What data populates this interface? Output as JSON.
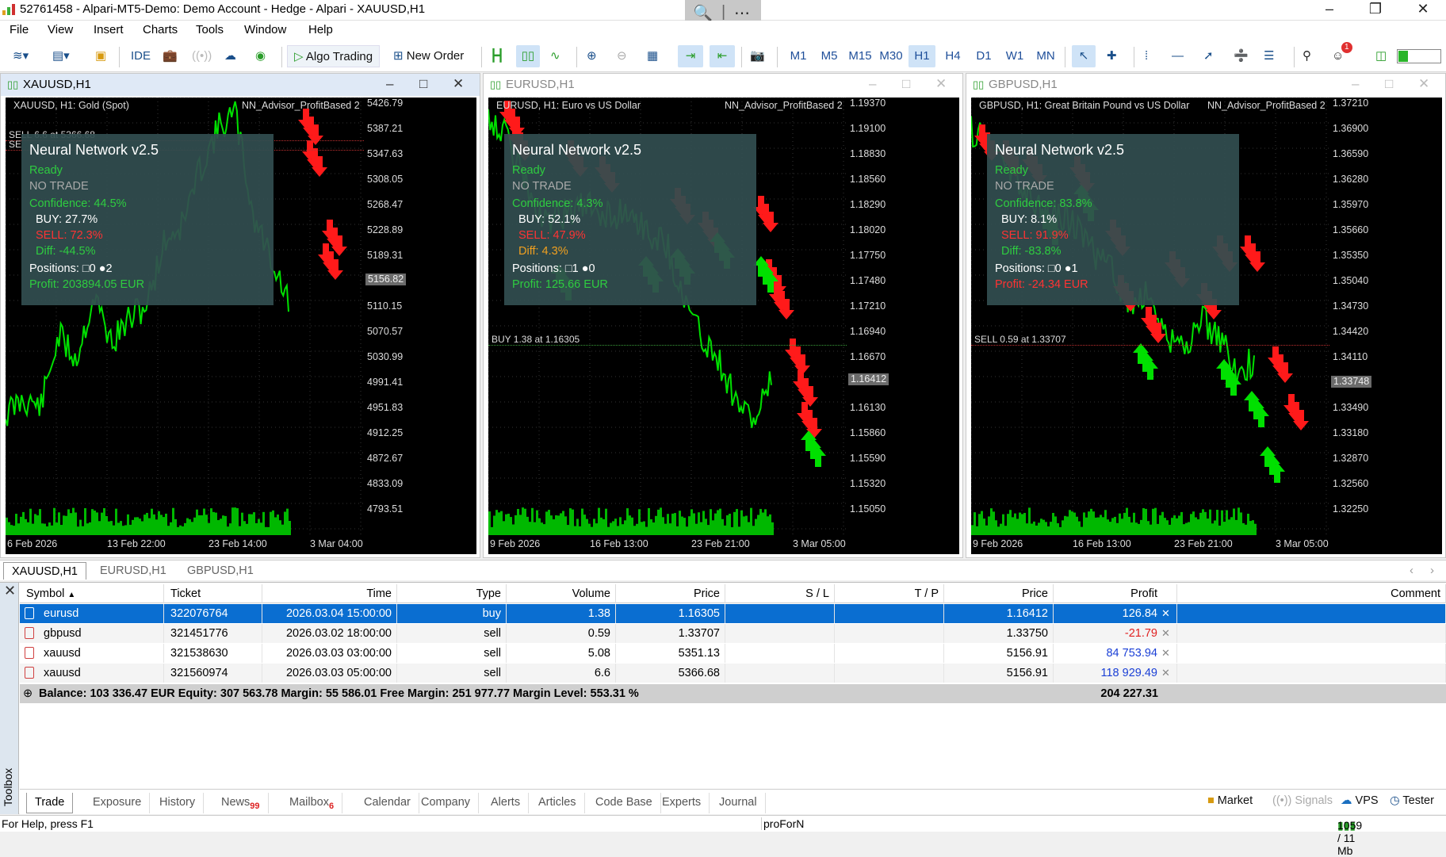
{
  "window": {
    "title": "52761458 - Alpari-MT5-Demo: Demo Account - Hedge - Alpari - XAUUSD,H1"
  },
  "menu": [
    "File",
    "View",
    "Insert",
    "Charts",
    "Tools",
    "Window",
    "Help"
  ],
  "toolbar": {
    "ide": "IDE",
    "algo_trading": "Algo Trading",
    "new_order": "New Order",
    "timeframes": [
      "M1",
      "M5",
      "M15",
      "M30",
      "H1",
      "H4",
      "D1",
      "W1",
      "MN"
    ],
    "selected_timeframe": "H1",
    "notif_count": "1"
  },
  "charts": [
    {
      "window_title": "XAUUSD,H1",
      "header": "XAUUSD, H1:  Gold (Spot)",
      "ea": "NN_Advisor_ProfitBased 2",
      "yticks": [
        "5426.79",
        "5387.21",
        "5347.63",
        "5308.05",
        "5268.47",
        "5228.89",
        "5189.31",
        "5149.73",
        "5110.15",
        "5070.57",
        "5030.99",
        "4991.41",
        "4951.83",
        "4912.25",
        "4872.67",
        "4833.09",
        "4793.51"
      ],
      "price_tag": "5156.82",
      "xticks": [
        "6 Feb 2026",
        "13 Feb 22:00",
        "23 Feb 14:00",
        "3 Mar 04:00"
      ],
      "trade_lines": [
        "SELL 6.6 at 5366.68",
        "SE"
      ],
      "panel": {
        "title": "Neural Network v2.5",
        "status": "Ready",
        "signal": "NO TRADE",
        "confidence": "Confidence: 44.5%",
        "buy": "BUY:  27.7%",
        "sell": "SELL: 72.3%",
        "diff": "Diff: -44.5%",
        "positions": "Positions: □0 ●2",
        "profit": "Profit: 203894.05 EUR"
      }
    },
    {
      "window_title": "EURUSD,H1",
      "header": "EURUSD, H1:  Euro vs US Dollar",
      "ea": "NN_Advisor_ProfitBased 2",
      "yticks": [
        "1.19370",
        "1.19100",
        "1.18830",
        "1.18560",
        "1.18290",
        "1.18020",
        "1.17750",
        "1.17480",
        "1.17210",
        "1.16940",
        "1.16670",
        "1.16400",
        "1.16130",
        "1.15860",
        "1.15590",
        "1.15320",
        "1.15050"
      ],
      "price_tag": "1.16412",
      "xticks": [
        "9 Feb 2026",
        "16 Feb 13:00",
        "23 Feb 21:00",
        "3 Mar 05:00"
      ],
      "trade_lines": [
        "BUY 1.38 at 1.16305"
      ],
      "panel": {
        "title": "Neural Network v2.5",
        "status": "Ready",
        "signal": "NO TRADE",
        "confidence": "Confidence: 4.3%",
        "buy": "BUY:  52.1%",
        "sell": "SELL: 47.9%",
        "diff": "Diff: 4.3%",
        "positions": "Positions: □1 ●0",
        "profit": "Profit: 125.66 EUR"
      }
    },
    {
      "window_title": "GBPUSD,H1",
      "header": "GBPUSD, H1:  Great Britain Pound vs US Dollar",
      "ea": "NN_Advisor_ProfitBased 2",
      "yticks": [
        "1.37210",
        "1.36900",
        "1.36590",
        "1.36280",
        "1.35970",
        "1.35660",
        "1.35350",
        "1.35040",
        "1.34730",
        "1.34420",
        "1.34110",
        "1.33800",
        "1.33490",
        "1.33180",
        "1.32870",
        "1.32560",
        "1.32250"
      ],
      "price_tag": "1.33748",
      "xticks": [
        "9 Feb 2026",
        "16 Feb 13:00",
        "23 Feb 21:00",
        "3 Mar 05:00"
      ],
      "trade_lines": [
        "SELL 0.59 at 1.33707"
      ],
      "panel": {
        "title": "Neural Network v2.5",
        "status": "Ready",
        "signal": "NO TRADE",
        "confidence": "Confidence: 83.8%",
        "buy": "BUY:  8.1%",
        "sell": "SELL: 91.9%",
        "diff": "Diff: -83.8%",
        "positions": "Positions: □0 ●1",
        "profit": "Profit: -24.34 EUR"
      }
    }
  ],
  "chart_tabs": [
    "XAUUSD,H1",
    "EURUSD,H1",
    "GBPUSD,H1"
  ],
  "active_chart_tab": "XAUUSD,H1",
  "trade_table": {
    "columns": [
      "Symbol",
      "Ticket",
      "Time",
      "Type",
      "Volume",
      "Price",
      "S / L",
      "T / P",
      "Price",
      "Profit",
      "Comment"
    ],
    "rows": [
      {
        "symbol": "eurusd",
        "ticket": "322076764",
        "time": "2026.03.04 15:00:00",
        "type": "buy",
        "volume": "1.38",
        "price": "1.16305",
        "sl": "",
        "tp": "",
        "cur": "1.16412",
        "profit": "126.84",
        "comment": "",
        "selected": true
      },
      {
        "symbol": "gbpusd",
        "ticket": "321451776",
        "time": "2026.03.02 18:00:00",
        "type": "sell",
        "volume": "0.59",
        "price": "1.33707",
        "sl": "",
        "tp": "",
        "cur": "1.33750",
        "profit": "-21.79",
        "comment": ""
      },
      {
        "symbol": "xauusd",
        "ticket": "321538630",
        "time": "2026.03.03 03:00:00",
        "type": "sell",
        "volume": "5.08",
        "price": "5351.13",
        "sl": "",
        "tp": "",
        "cur": "5156.91",
        "profit": "84 753.94",
        "comment": ""
      },
      {
        "symbol": "xauusd",
        "ticket": "321560974",
        "time": "2026.03.03 05:00:00",
        "type": "sell",
        "volume": "6.6",
        "price": "5366.68",
        "sl": "",
        "tp": "",
        "cur": "5156.91",
        "profit": "118 929.49",
        "comment": ""
      }
    ],
    "summary": "Balance: 103 336.47 EUR  Equity: 307 563.78  Margin: 55 586.01  Free Margin: 251 977.77  Margin Level: 553.31 %",
    "total_profit": "204 227.31"
  },
  "toolbox": {
    "label": "Toolbox",
    "tabs": [
      {
        "label": "Trade",
        "badge": ""
      },
      {
        "label": "Exposure",
        "badge": ""
      },
      {
        "label": "History",
        "badge": ""
      },
      {
        "label": "News",
        "badge": "99"
      },
      {
        "label": "Mailbox",
        "badge": "6"
      },
      {
        "label": "Calendar",
        "badge": ""
      },
      {
        "label": "Company",
        "badge": ""
      },
      {
        "label": "Alerts",
        "badge": ""
      },
      {
        "label": "Articles",
        "badge": ""
      },
      {
        "label": "Code Base",
        "badge": ""
      },
      {
        "label": "Experts",
        "badge": ""
      },
      {
        "label": "Journal",
        "badge": ""
      }
    ],
    "active_tab": "Trade",
    "right": {
      "market": "Market",
      "signals": "Signals",
      "vps": "VPS",
      "tester": "Tester"
    }
  },
  "status": {
    "help": "For Help, press F1",
    "profile": "proForN",
    "traffic": "1059 / 11 Mb"
  },
  "colors": {
    "bull": "#00e000",
    "bear": "#ff1a1a",
    "panel_bg": "#324e50",
    "selection": "#0a6ed1",
    "profit_pos": "#1a3fd6",
    "profit_neg": "#e02020"
  }
}
